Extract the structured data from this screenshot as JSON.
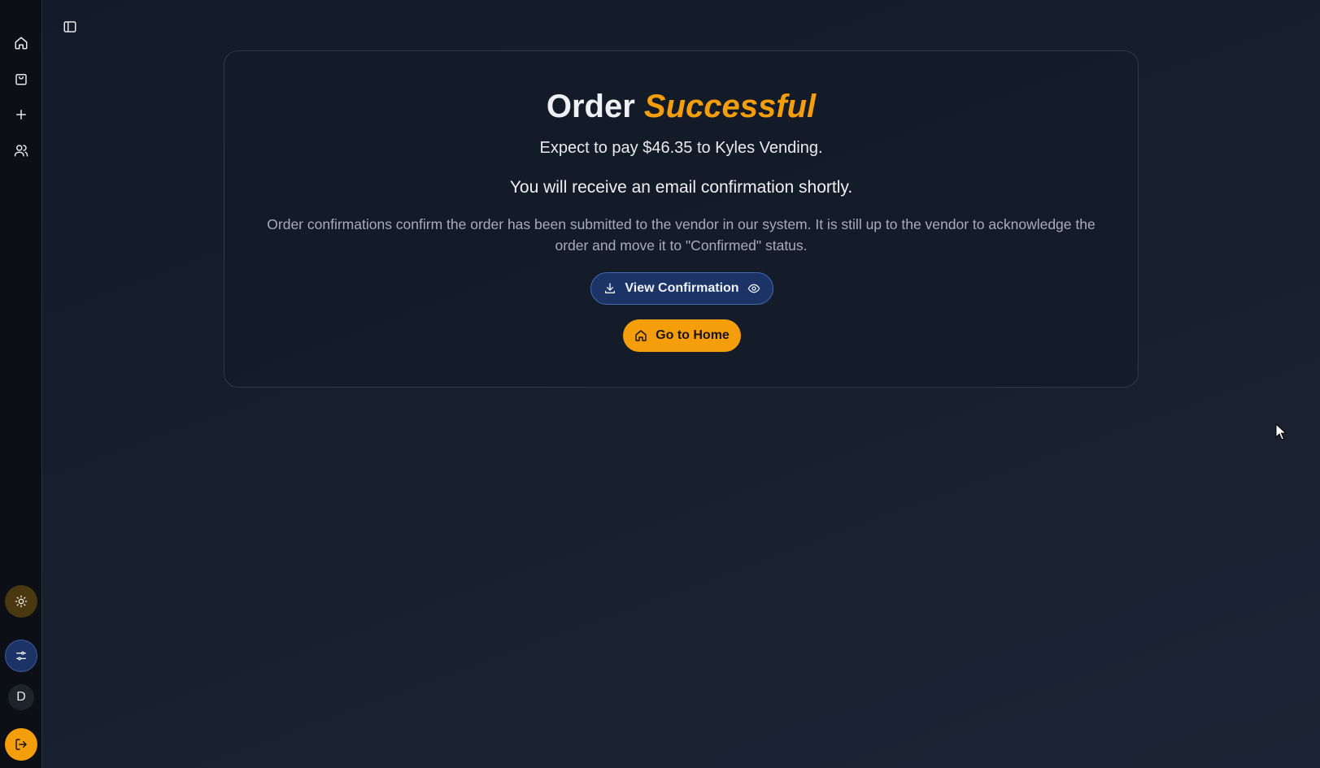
{
  "sidebar": {
    "nav_icons": [
      "home-icon",
      "shopping-bag-icon",
      "plus-icon",
      "users-icon"
    ],
    "avatar_initial": "D"
  },
  "order": {
    "title_main": "Order",
    "title_accent": "Successful",
    "pay_line": "Expect to pay $46.35 to Kyles Vending.",
    "email_line": "You will receive an email confirmation shortly.",
    "note": "Order confirmations confirm the order has been submitted to the vendor in our system. It is still up to the vendor to acknowledge the order and move it to \"Confirmed\" status."
  },
  "actions": {
    "view_confirmation_label": "View Confirmation",
    "go_home_label": "Go to Home"
  },
  "colors": {
    "accent": "#f59e0b",
    "primary_blue": "#1c3366",
    "background": "#161e2d",
    "sidebar_bg": "#0c0f15"
  }
}
